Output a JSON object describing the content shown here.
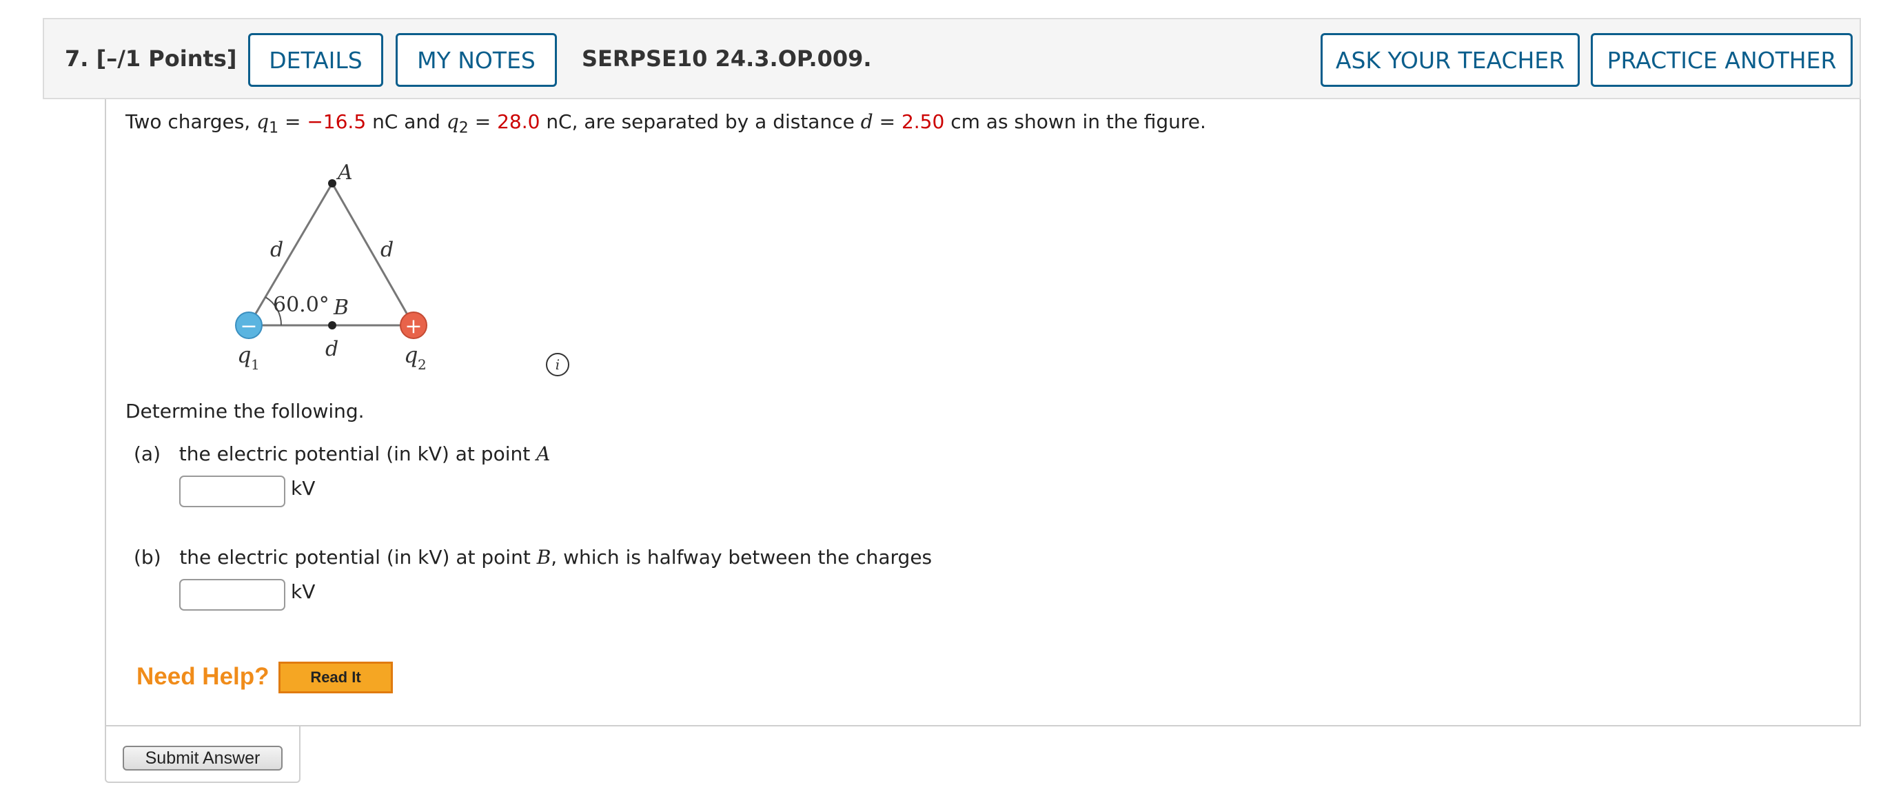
{
  "header": {
    "question_number": "7.",
    "points": "[–/1 Points]",
    "details_label": "DETAILS",
    "my_notes_label": "MY NOTES",
    "problem_code": "SERPSE10 24.3.OP.009.",
    "ask_teacher_label": "ASK YOUR TEACHER",
    "practice_label": "PRACTICE ANOTHER"
  },
  "problem": {
    "intro": "Two charges,",
    "q1_symbol": "q",
    "q1_sub": "1",
    "eq": "=",
    "q1_value": "−16.5",
    "unit_nc_and": "nC and",
    "q2_symbol": "q",
    "q2_sub": "2",
    "q2_value": "28.0",
    "unit_nc_sep": "nC, are separated by a distance",
    "d_symbol": "d",
    "d_value": "2.50",
    "tail": "cm as shown in the figure."
  },
  "figure": {
    "label_A": "A",
    "label_B": "B",
    "label_d_left": "d",
    "label_d_right": "d",
    "label_d_bottom": "d",
    "angle": "60.0°",
    "q1_label": "q",
    "q1_sub": "1",
    "q2_label": "q",
    "q2_sub": "2",
    "minus_sign": "−",
    "plus_sign": "+",
    "info_symbol": "i",
    "colors": {
      "negative": "#5ab4e0",
      "positive": "#e8634a",
      "line": "#777777"
    }
  },
  "instructions": "Determine the following.",
  "parts": [
    {
      "label": "(a)",
      "text_pre": "the electric potential (in kV) at point",
      "point": "A",
      "text_post": "",
      "unit": "kV",
      "value": ""
    },
    {
      "label": "(b)",
      "text_pre": "the electric potential (in kV) at point",
      "point": "B",
      "text_post": ", which is halfway between the charges",
      "unit": "kV",
      "value": ""
    }
  ],
  "help": {
    "need_help": "Need Help?",
    "read_it": "Read It"
  },
  "submit_label": "Submit Answer",
  "colors": {
    "accent": "#0b5e8c",
    "red_values": "#cc0000",
    "help_orange": "#f08c1a"
  }
}
